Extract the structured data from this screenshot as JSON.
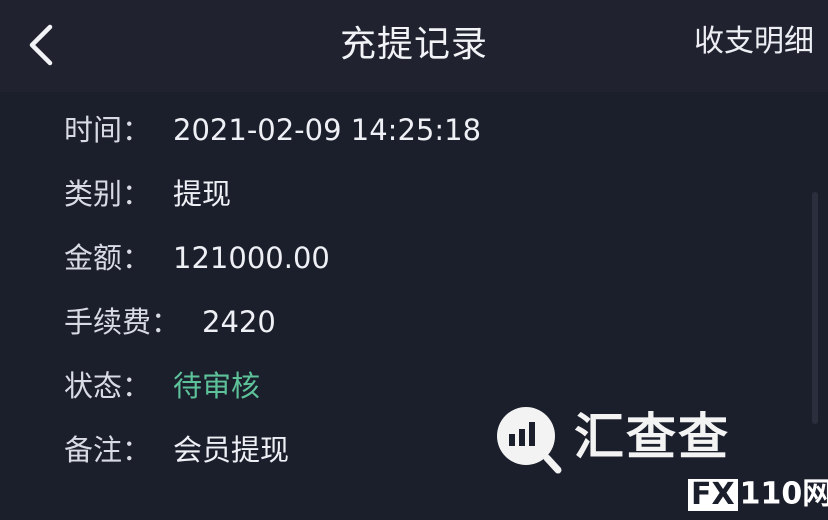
{
  "nav": {
    "title": "充提记录",
    "right_label": "收支明细"
  },
  "detail": {
    "time": {
      "label": "时间：",
      "value": "2021-02-09 14:25:18"
    },
    "category": {
      "label": "类别：",
      "value": "提现"
    },
    "amount": {
      "label": "金额：",
      "value": "121000.00"
    },
    "fee": {
      "label": "手续费：",
      "value": "2420"
    },
    "status": {
      "label": "状态：",
      "value": "待审核"
    },
    "remark": {
      "label": "备注：",
      "value": "会员提现"
    }
  },
  "colors": {
    "background": "#1b1e2b",
    "nav_background": "#20232f",
    "status_pending": "#5dc29a"
  },
  "watermark": {
    "brand": "汇查查",
    "badge_fx": "FX",
    "badge_rest": "110网"
  }
}
